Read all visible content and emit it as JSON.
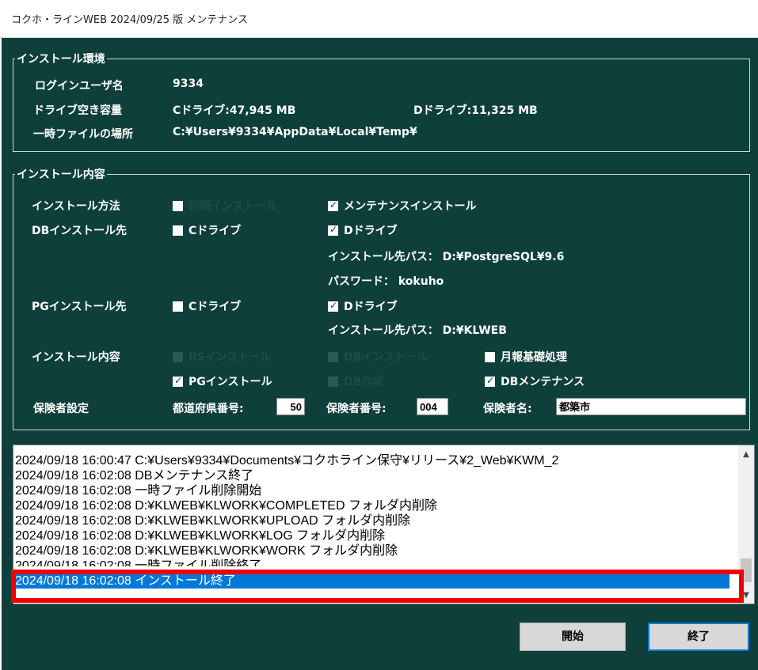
{
  "window": {
    "title": "コクホ・ラインWEB 2024/09/25 版 メンテナンス"
  },
  "env": {
    "legend": "インストール環境",
    "login_label": "ログインユーザ名",
    "login_value": "9334",
    "disk_label": "ドライブ空き容量",
    "c_drive": "Cドライブ:47,945 MB",
    "d_drive": "Dドライブ:11,325 MB",
    "temp_label": "一時ファイルの場所",
    "temp_value": "C:¥Users¥9334¥AppData¥Local¥Temp¥"
  },
  "content": {
    "legend": "インストール内容",
    "method_label": "インストール方法",
    "method_opt1": "初期インストール",
    "method_opt2": "メンテナンスインストール",
    "db_label": "DBインストール先",
    "db_c": "Cドライブ",
    "db_d": "Dドライブ",
    "db_path": "インストール先パス： D:¥PostgreSQL¥9.6",
    "db_password": "パスワード： kokuho",
    "pg_label": "PGインストール先",
    "pg_c": "Cドライブ",
    "pg_d": "Dドライブ",
    "pg_path": "インストール先パス： D:¥KLWEB",
    "items_label": "インストール内容",
    "item_iis": "IISインストール",
    "item_db_install": "DBインストール",
    "item_monthly": "月報基礎処理",
    "item_pg": "PGインストール",
    "item_db_create": "DB作成",
    "item_db_maint": "DBメンテナンス",
    "insurer_label": "保険者設定",
    "pref_label": "都道府県番号:",
    "pref_value": "50",
    "insurer_no_label": "保険者番号:",
    "insurer_no_value": "004",
    "insurer_name_label": "保険者名:",
    "insurer_name_value": "都築市"
  },
  "log": {
    "lines": [
      "2024/09/18 16:00:47 C:¥Users¥9334¥Documents¥コクホライン保守¥リリース¥2_Web¥KWM_2",
      "2024/09/18 16:02:08 DBメンテナンス終了",
      "2024/09/18 16:02:08 一時ファイル削除開始",
      "2024/09/18 16:02:08 D:¥KLWEB¥KLWORK¥COMPLETED フォルダ内削除",
      "2024/09/18 16:02:08 D:¥KLWEB¥KLWORK¥UPLOAD フォルダ内削除",
      "2024/09/18 16:02:08 D:¥KLWEB¥KLWORK¥LOG フォルダ内削除",
      "2024/09/18 16:02:08 D:¥KLWEB¥KLWORK¥WORK フォルダ内削除",
      "2024/09/18 16:02:08 一時ファイル削除終了",
      "2024/09/18 16:02:08 インストール終了"
    ],
    "selected_index": 8
  },
  "buttons": {
    "start": "開始",
    "end": "終了"
  },
  "colors": {
    "background": "#0e3f3b",
    "selection": "#0078d7",
    "highlight": "#ee0000"
  }
}
